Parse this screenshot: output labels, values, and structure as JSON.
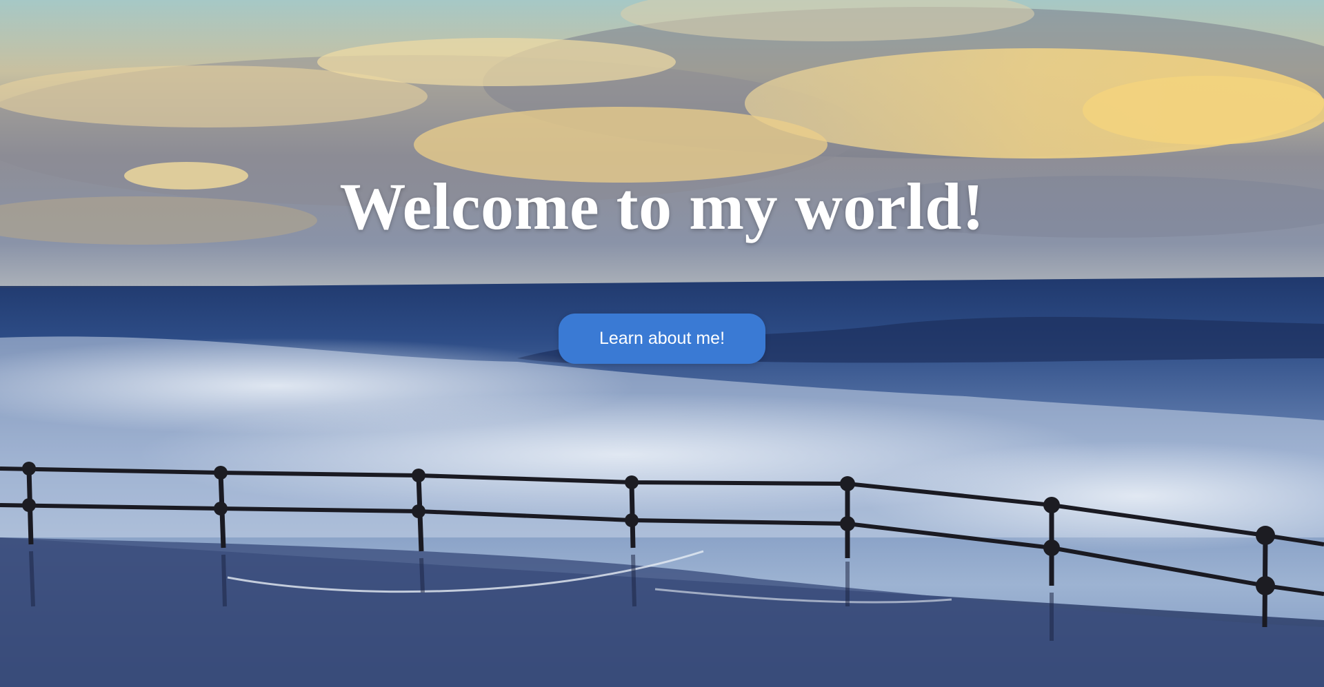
{
  "hero": {
    "title": "Welcome to my world!",
    "button_label": "Learn about me!"
  },
  "colors": {
    "button": "#3a7ad4",
    "title": "#ffffff",
    "sky_top": "#a9c9c7",
    "sea": "#2a4a82"
  },
  "background": {
    "description_icon": "seascape-photo"
  }
}
